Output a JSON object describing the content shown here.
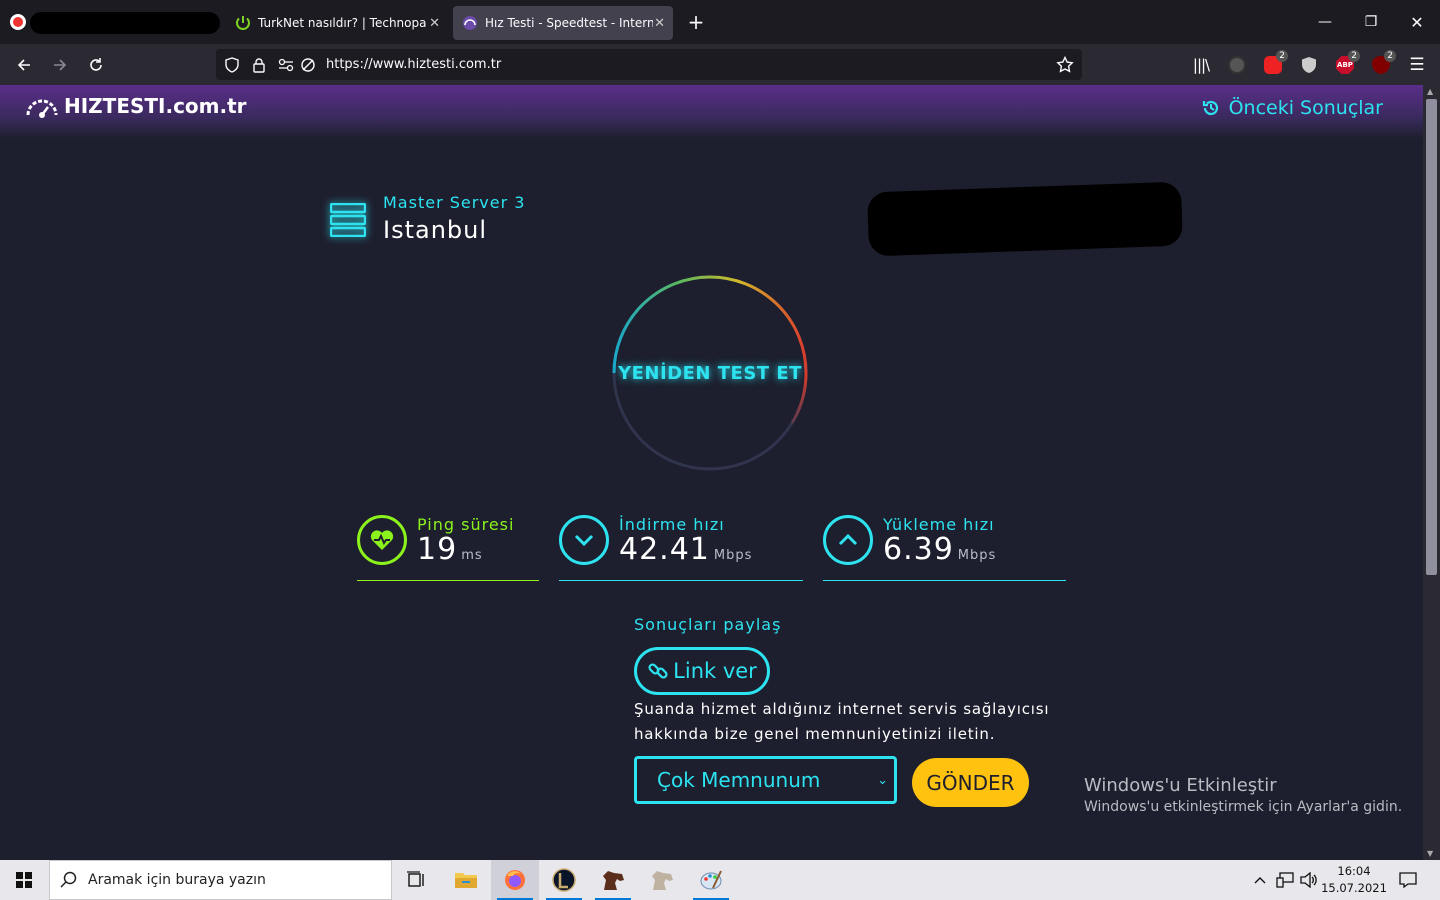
{
  "browser": {
    "tabs": [
      {
        "title": "TurkNet nasıldır? | Technopat So"
      },
      {
        "title": "Hız Testi - Speedtest - Internet H"
      }
    ],
    "url": "https://www.hiztesti.com.tr",
    "extension_badges": [
      "2",
      "2",
      "2"
    ]
  },
  "site": {
    "logo": "HIZTESTI.com.tr",
    "previous_results": "Önceki Sonuçlar"
  },
  "server": {
    "name": "Master Server 3",
    "city": "Istanbul"
  },
  "gauge": {
    "label": "YENİDEN TEST ET"
  },
  "metrics": {
    "ping": {
      "title": "Ping süresi",
      "value": "19",
      "unit": "ms"
    },
    "download": {
      "title": "İndirme hızı",
      "value": "42.41",
      "unit": "Mbps"
    },
    "upload": {
      "title": "Yükleme hızı",
      "value": "6.39",
      "unit": "Mbps"
    }
  },
  "share": {
    "title": "Sonuçları paylaş",
    "link_button": "Link ver"
  },
  "survey": {
    "text": "Şuanda hizmet aldığınız internet servis sağlayıcısı hakkında bize genel memnuniyetinizi iletin.",
    "selected": "Çok Memnunum",
    "send_button": "GÖNDER"
  },
  "watermark": {
    "line1": "Windows'u Etkinleştir",
    "line2": "Windows'u etkinleştirmek için Ayarlar'a gidin."
  },
  "taskbar": {
    "search_placeholder": "Aramak için buraya yazın",
    "time": "16:04",
    "date": "15.07.2021"
  },
  "colors": {
    "accent": "#2de3f0",
    "ping": "#8bf21c",
    "send": "#ffc20e",
    "background": "#1d1f2e"
  }
}
